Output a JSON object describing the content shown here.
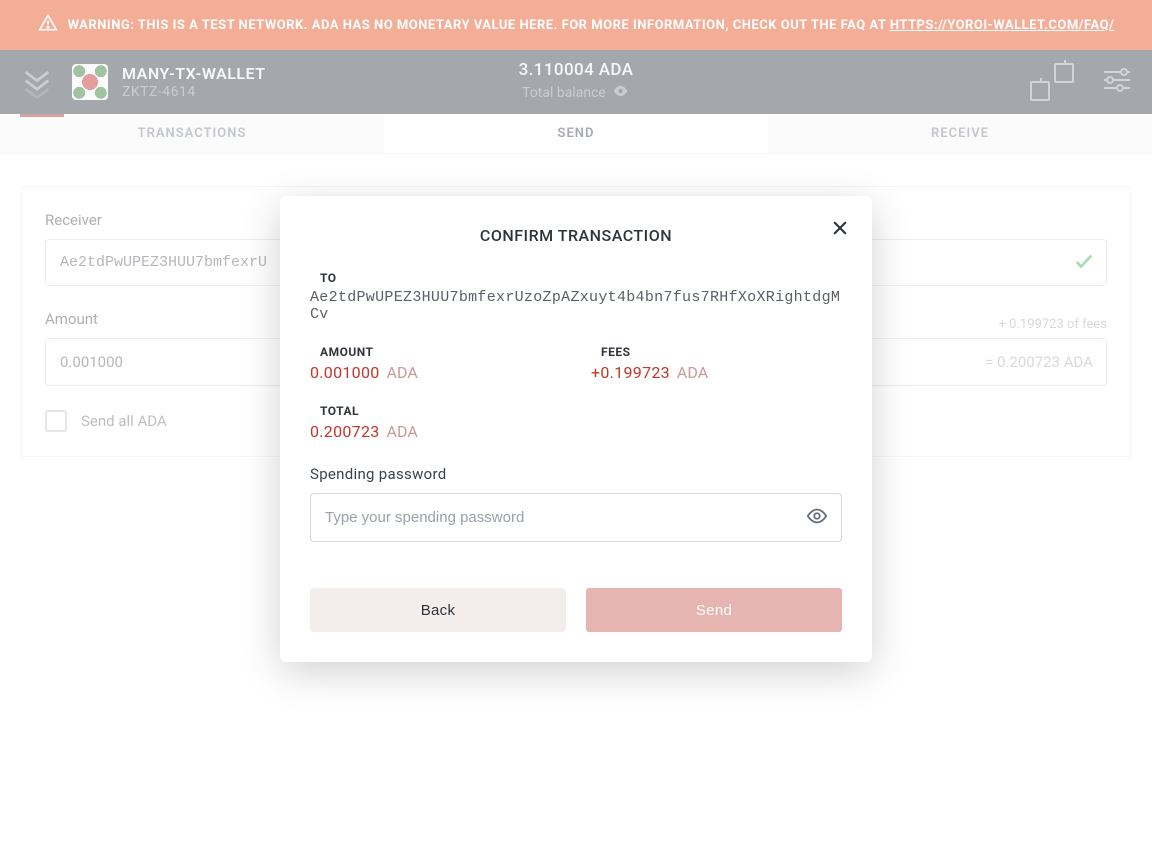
{
  "warning": {
    "prefix": "WARNING: THIS IS A TEST NETWORK. ADA HAS NO MONETARY VALUE HERE. FOR MORE INFORMATION, CHECK OUT THE FAQ AT ",
    "link": "HTTPS://YOROI-WALLET.COM/FAQ/"
  },
  "header": {
    "wallet_name": "MANY-TX-WALLET",
    "wallet_sub": "ZKTZ-4614",
    "balance": "3.110004 ADA",
    "balance_label": "Total balance"
  },
  "tabs": {
    "transactions": "TRANSACTIONS",
    "send": "SEND",
    "receive": "RECEIVE"
  },
  "form": {
    "receiver_label": "Receiver",
    "receiver_value": "Ae2tdPwUPEZ3HUU7bmfexrU",
    "amount_label": "Amount",
    "amount_value": "0.001000",
    "fees_hint": "+ 0.199723 of fees",
    "equals_hint": "= 0.200723 ADA",
    "send_all_label": "Send all ADA"
  },
  "modal": {
    "title": "CONFIRM TRANSACTION",
    "to_label": "TO",
    "to_address": "Ae2tdPwUPEZ3HUU7bmfexrUzoZpAZxuyt4b4bn7fus7RHfXoXRightdgMCv",
    "amount_label": "AMOUNT",
    "amount_value": "0.001000",
    "amount_suffix": "ADA",
    "fees_label": "FEES",
    "fees_value": "+0.199723",
    "fees_suffix": "ADA",
    "total_label": "TOTAL",
    "total_value": "0.200723",
    "total_suffix": "ADA",
    "password_label": "Spending password",
    "password_placeholder": "Type your spending password",
    "back_button": "Back",
    "send_button": "Send"
  }
}
